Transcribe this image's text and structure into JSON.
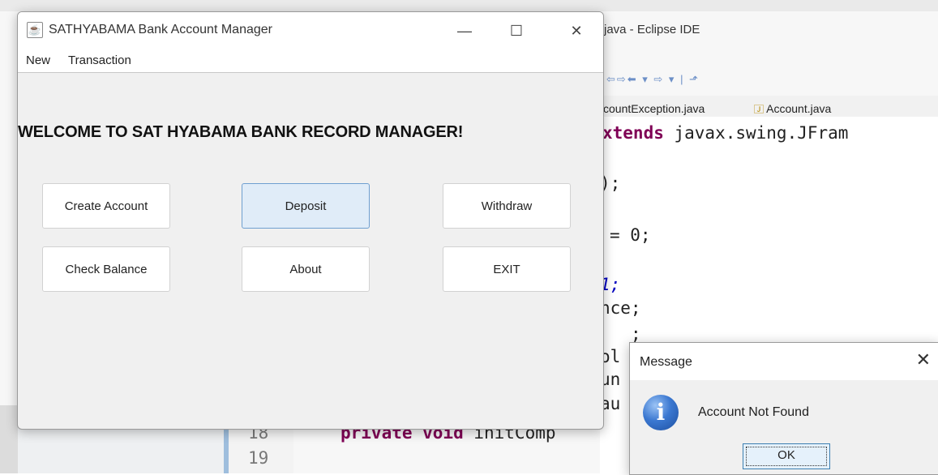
{
  "eclipse": {
    "title_fragment": "java - Eclipse IDE",
    "toolbar_glyphs": "⇦⇨⬅ ▾ ⇨ ▾ | ⬏",
    "tabs": [
      "countException.java",
      "Account.java"
    ],
    "code_lines": {
      "l1_kw": "xtends",
      "l1_rest": " javax.swing.JFram",
      "l2": ");",
      "l3": "= 0;",
      "l4": "1;",
      "l5": "nce;",
      "l6": ";",
      "l7": "ol",
      "l8": "un",
      "l9": "au",
      "l18_kw": "private void",
      "l18_rest": " initComp"
    },
    "line_numbers": [
      "18",
      "19"
    ]
  },
  "app": {
    "title": "SATHYABAMA Bank Account Manager",
    "menu": [
      "New",
      "Transaction"
    ],
    "welcome": "WELCOME TO SAT HYABAMA BANK RECORD MANAGER!",
    "buttons": {
      "create_account": "Create Account",
      "deposit": "Deposit",
      "withdraw": "Withdraw",
      "check_balance": "Check Balance",
      "about": "About",
      "exit": "EXIT"
    },
    "window_controls": {
      "minimize": "—",
      "maximize": "☐",
      "close": "✕"
    }
  },
  "dialog": {
    "title": "Message",
    "close": "✕",
    "icon_glyph": "i",
    "message": "Account Not Found",
    "ok": "OK"
  }
}
